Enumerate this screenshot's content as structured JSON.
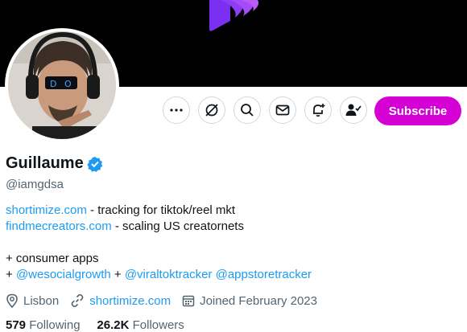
{
  "colors": {
    "banner": "#000000",
    "subscribe_bg": "#d400d4",
    "verified": "#1d9bf0",
    "link": "#1d9bf0",
    "logo": "#7b2ff0"
  },
  "banner": {
    "logo_icon": "purple-wave-logo"
  },
  "actions": {
    "more_icon": "more-icon",
    "grok_icon": "grok-icon",
    "search_icon": "search-icon",
    "message_icon": "mail-icon",
    "notify_icon": "bell-plus-icon",
    "following_icon": "person-check-icon",
    "subscribe_label": "Subscribe"
  },
  "profile": {
    "name": "Guillaume",
    "handle": "@iamgdsa",
    "verified_icon": "verified-badge-icon"
  },
  "bio": {
    "line1_link": "shortimize.com",
    "line1_text": " - tracking for tiktok/reel mkt",
    "line2_link": "findmecreators.com",
    "line2_text": " - scaling US creatornets",
    "line4_text": "+ consumer apps",
    "line5_prefix": "+ ",
    "line5_link1": "@wesocialgrowth",
    "line5_mid": " + ",
    "line5_link2": "@viraltoktracker",
    "line5_sep": " ",
    "line5_link3": "@appstoretracker"
  },
  "meta": {
    "location": "Lisbon",
    "website": "shortimize.com",
    "joined": "Joined February 2023"
  },
  "stats": {
    "following_count": "579",
    "following_label": " Following",
    "followers_count": "26.2K",
    "followers_label": " Followers"
  }
}
